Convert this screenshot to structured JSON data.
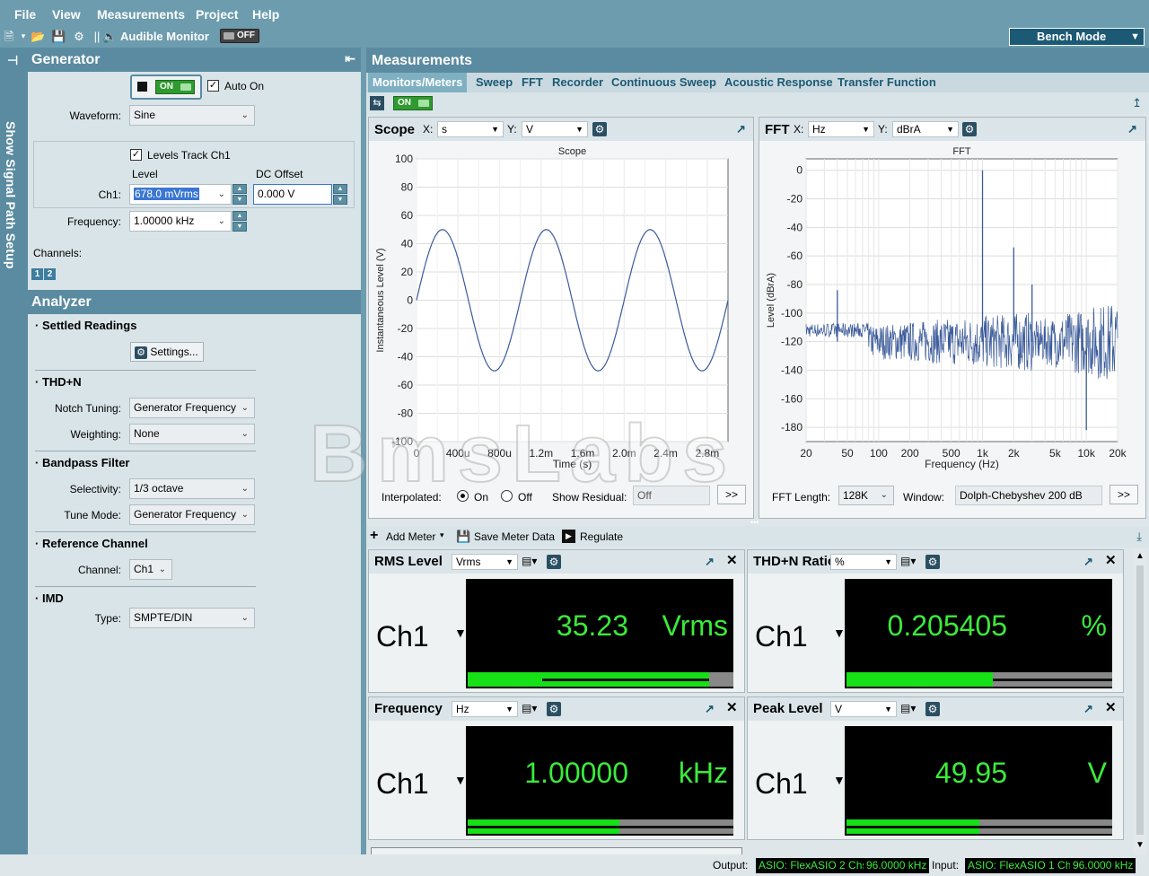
{
  "menu": {
    "file": "File",
    "view": "View",
    "measurements": "Measurements",
    "project": "Project",
    "help": "Help"
  },
  "toolbar": {
    "audible_monitor": "Audible Monitor",
    "monitor_toggle": "OFF",
    "bench_mode": "Bench Mode"
  },
  "side_tab": {
    "label": "Show Signal Path Setup"
  },
  "generator": {
    "title": "Generator",
    "toggle": "ON",
    "auto_on": "Auto On",
    "auto_on_checked": true,
    "waveform_label": "Waveform:",
    "waveform": "Sine",
    "levels_track": "Levels Track Ch1",
    "level_label": "Level",
    "dc_offset_label": "DC Offset",
    "ch1_label": "Ch1:",
    "ch1_level": "678.0 mVrms",
    "dc_offset": "0.000 V",
    "frequency_label": "Frequency:",
    "frequency": "1.00000 kHz",
    "channels_label": "Channels:",
    "channels": [
      "1",
      "2"
    ]
  },
  "analyzer": {
    "title": "Analyzer",
    "settled_readings": "Settled Readings",
    "settings_button": "Settings...",
    "thdn": "THD+N",
    "notch_label": "Notch Tuning:",
    "notch": "Generator Frequency",
    "weighting_label": "Weighting:",
    "weighting": "None",
    "bandpass": "Bandpass Filter",
    "selectivity_label": "Selectivity:",
    "selectivity": "1/3 octave",
    "tune_label": "Tune Mode:",
    "tune": "Generator Frequency",
    "reference": "Reference Channel",
    "channel_label": "Channel:",
    "channel": "Ch1",
    "imd": "IMD",
    "type_label": "Type:",
    "type": "SMPTE/DIN"
  },
  "measurements": {
    "title": "Measurements",
    "tabs": [
      "Monitors/Meters",
      "Sweep",
      "FFT",
      "Recorder",
      "Continuous Sweep",
      "Acoustic Response",
      "Transfer Function"
    ],
    "toggle": "ON"
  },
  "scope": {
    "title": "Scope",
    "x_label": "X:",
    "x_unit": "s",
    "y_label": "Y:",
    "y_unit": "V",
    "interpolated_label": "Interpolated:",
    "on_label": "On",
    "off_label": "Off",
    "show_residual_label": "Show Residual:",
    "show_residual": "Off",
    "more": ">>"
  },
  "fft": {
    "title": "FFT",
    "x_label": "X:",
    "x_unit": "Hz",
    "y_label": "Y:",
    "y_unit": "dBrA",
    "length_label": "FFT Length:",
    "length": "128K",
    "window_label": "Window:",
    "window": "Dolph-Chebyshev 200 dB",
    "more": ">>"
  },
  "chart_data": [
    {
      "type": "line",
      "title": "Scope",
      "xlabel": "Time (s)",
      "ylabel": "Instantaneous Level (V)",
      "xlim": [
        0,
        0.003
      ],
      "ylim": [
        -100,
        100
      ],
      "x_ticks": [
        "0",
        "400u",
        "800u",
        "1.2m",
        "1.6m",
        "2.0m",
        "2.4m",
        "2.8m"
      ],
      "y_ticks": [
        "100",
        "80",
        "60",
        "40",
        "20",
        "0",
        "-20",
        "-40",
        "-60",
        "-80",
        "-100"
      ],
      "series": [
        {
          "amplitude": 49.95,
          "frequency_hz": 1000,
          "color": "#3b5b9a"
        }
      ],
      "grid": true
    },
    {
      "type": "line",
      "title": "FFT",
      "xlabel": "Frequency (Hz)",
      "ylabel": "Level (dBrA)",
      "x_scale": "log",
      "xlim": [
        20,
        20000
      ],
      "ylim": [
        -190,
        8
      ],
      "x_ticks": [
        "20",
        "50",
        "100",
        "200",
        "500",
        "1k",
        "2k",
        "5k",
        "10k",
        "20k"
      ],
      "y_ticks": [
        "0",
        "-20",
        "-40",
        "-60",
        "-80",
        "-100",
        "-120",
        "-140",
        "-160",
        "-180"
      ],
      "peaks": [
        {
          "x": 40,
          "y": -84
        },
        {
          "x": 1000,
          "y": 0
        },
        {
          "x": 2000,
          "y": -54
        },
        {
          "x": 3000,
          "y": -80
        },
        {
          "x": 10000,
          "y": -182
        }
      ],
      "noise_floor": -120,
      "grid": true
    }
  ],
  "meter_toolbar": {
    "add_meter": "Add Meter",
    "save": "Save Meter Data",
    "regulate": "Regulate"
  },
  "meters": [
    {
      "title": "RMS Level",
      "unit_sel": "Vrms",
      "channel": "Ch1",
      "value": "35.23",
      "unit": "Vrms",
      "fill": 0.91,
      "needle_from": 0.28,
      "needle_to": 0.91
    },
    {
      "title": "THD+N Ratio",
      "unit_sel": "%",
      "channel": "Ch1",
      "value": "0.205405",
      "unit": "%",
      "fill": 0.55,
      "needle_from": 0.55,
      "needle_to": 1.0
    },
    {
      "title": "Frequency",
      "unit_sel": "Hz",
      "channel": "Ch1",
      "value": "1.00000",
      "unit": "kHz",
      "fill": 0.57,
      "needle_from": 0.0,
      "needle_to": 1.0
    },
    {
      "title": "Peak Level",
      "unit_sel": "V",
      "channel": "Ch1",
      "value": "49.95",
      "unit": "V",
      "fill": 0.5,
      "needle_from": 0.0,
      "needle_to": 1.0
    }
  ],
  "status": {
    "output_label": "Output:",
    "output_device": "ASIO: FlexASIO 2 Chs",
    "output_rate": "96.0000 kHz",
    "input_label": "Input:",
    "input_device": "ASIO: FlexASIO 1 Ch",
    "input_rate": "96.0000 kHz"
  },
  "watermark": "BmsLabs"
}
